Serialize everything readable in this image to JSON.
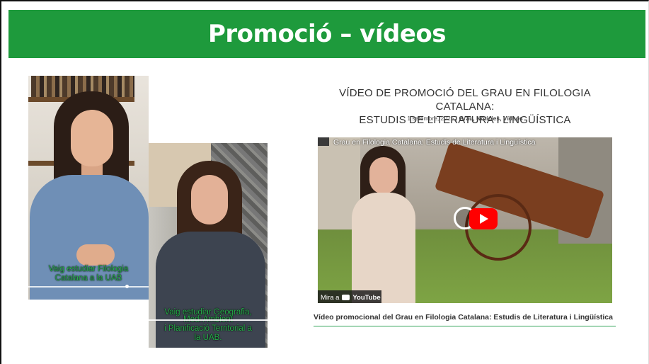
{
  "slide": {
    "title": "Promoció – vídeos"
  },
  "videos": {
    "phone1": {
      "caption_line1": "Vaig estudiar Filologia",
      "caption_line2": "Catalana a la UAB"
    },
    "phone2": {
      "caption_line1": "Vaig estudiar Geografia,",
      "caption_line2": "Medi Ambient",
      "caption_line3": "i Planificació Territorial a",
      "caption_line4": "la UAB."
    }
  },
  "article": {
    "title_line1": "VÍDEO DE PROMOCIÓ DEL GRAU EN FILOLOGIA CATALANA:",
    "title_line2": "ESTUDIS DE LITERATURA I LINGÜÍSTICA",
    "date": "1 setembre, 2025",
    "separator": "|",
    "categories": "Grau, Notícies, Vídeos",
    "youtube_title": "Grau en Filologia Catalana: Estudis de Literatura i Lingüística",
    "watch_on": "Mira a",
    "youtube_brand": "YouTube",
    "description": "Vídeo promocional del Grau en Filologia Catalana: Estudis de Literatura i Lingüística"
  },
  "colors": {
    "header_green": "#1e9a3c",
    "caption_green": "#27b04b",
    "youtube_red": "#ff0000"
  }
}
